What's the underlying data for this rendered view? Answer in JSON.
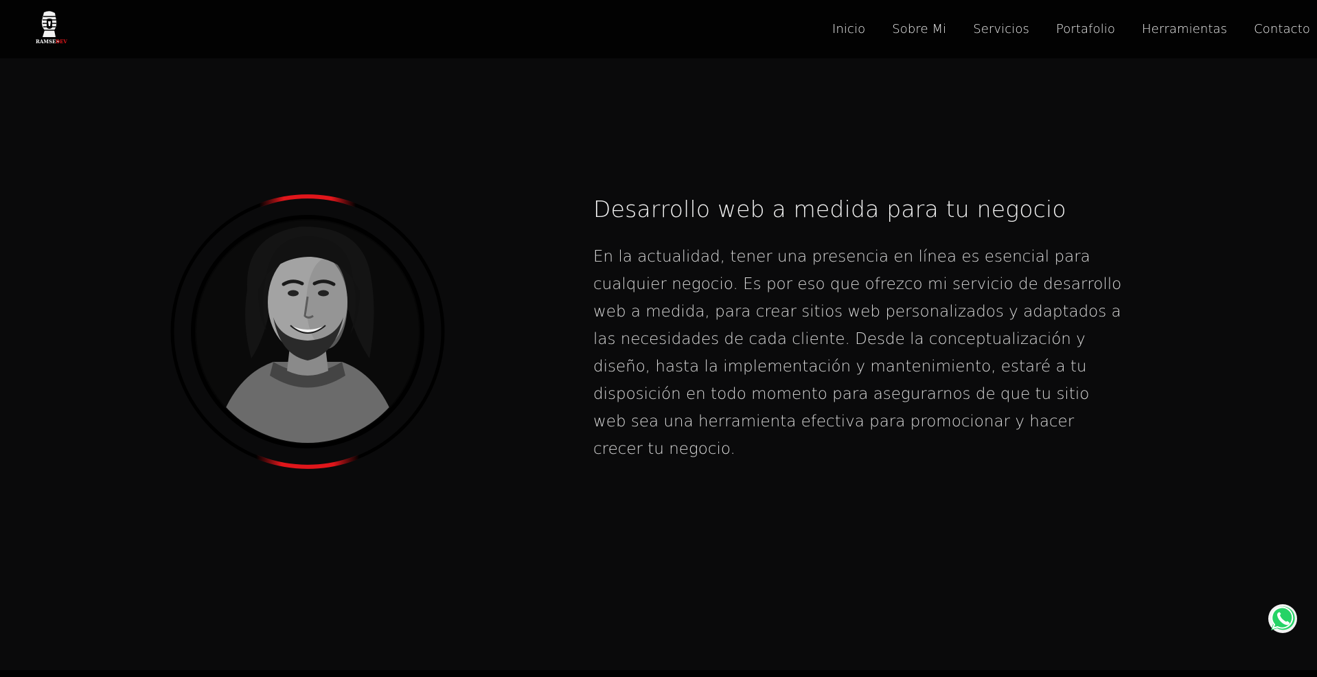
{
  "navbar": {
    "logo_icon": "ramsesdev-pharaoh-logo",
    "logo_text_main": "RAMSES",
    "logo_text_accent": "DEV",
    "links": [
      {
        "label": "Inicio"
      },
      {
        "label": "Sobre Mi"
      },
      {
        "label": "Servicios"
      },
      {
        "label": "Portafolio"
      },
      {
        "label": "Herramientas"
      },
      {
        "label": "Contacto"
      }
    ]
  },
  "hero": {
    "title": "Desarrollo web a medida para tu negocio",
    "paragraph": "En la actualidad, tener una presencia en línea es esencial para cualquier negocio. Es por eso que ofrezco mi servicio de desarrollo web a medida, para crear sitios web personalizados y adaptados a las necesidades de cada cliente. Desde la conceptualización y diseño, hasta la implementación y mantenimiento, estaré a tu disposición en todo momento para asegurarnos de que tu sitio web sea una herramienta efectiva para promocionar y hacer crecer tu negocio.",
    "portrait_icon": "profile-portrait"
  },
  "floating": {
    "whatsapp_icon": "whatsapp-icon"
  },
  "colors": {
    "background": "#0a0a0b",
    "navbar": "#020202",
    "accent": "#e0161b",
    "text": "#e6e6e6"
  }
}
